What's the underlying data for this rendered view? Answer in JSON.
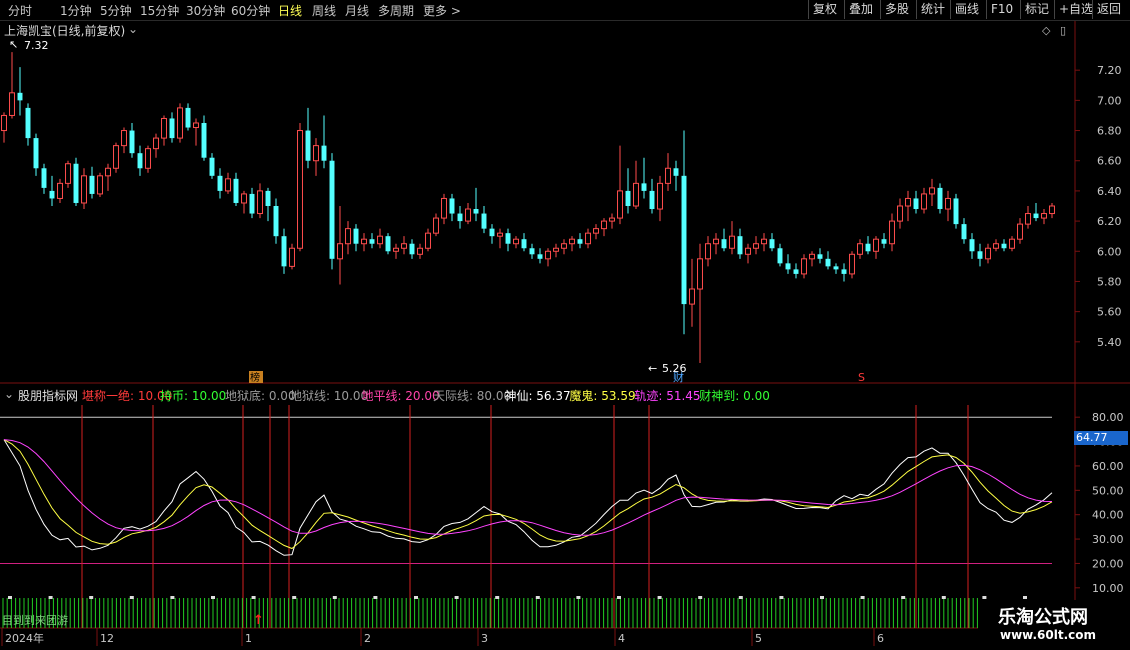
{
  "toolbar": {
    "periods": [
      "分时",
      "1分钟",
      "5分钟",
      "15分钟",
      "30分钟",
      "60分钟",
      "日线",
      "周线",
      "月线",
      "多周期",
      "更多 >"
    ],
    "active_period": "日线",
    "right_buttons": [
      "复权",
      "叠加",
      "多股",
      "统计",
      "画线",
      "F10",
      "标记",
      "+自选",
      "返回"
    ]
  },
  "chart_header": {
    "stock_title": "上海凯宝(日线,前复权)",
    "dropdown_icon": "chevron-down-icon"
  },
  "price_axis": [
    "7.20",
    "7.00",
    "6.80",
    "6.60",
    "6.40",
    "6.20",
    "6.00",
    "5.80",
    "5.60",
    "5.40"
  ],
  "annotations": {
    "high_label": "7.32",
    "low_label": "5.26",
    "tag_bang": "榜",
    "tag_cai": "财",
    "tag_s": "S"
  },
  "indicator": {
    "name": "股朋指标网",
    "items": [
      {
        "label": "堪称一绝:",
        "value": "10.00",
        "color": "#ff3a3a"
      },
      {
        "label": "持币:",
        "value": "10.00",
        "color": "#33ff33"
      },
      {
        "label": "地狱底:",
        "value": "0.00",
        "color": "#9a9a9a"
      },
      {
        "label": "地狱线:",
        "value": "10.00",
        "color": "#9a9a9a"
      },
      {
        "label": "地平线:",
        "value": "20.00",
        "color": "#ff44aa"
      },
      {
        "label": "天际线:",
        "value": "80.00",
        "color": "#9a9a9a"
      },
      {
        "label": "神仙:",
        "value": "56.37",
        "color": "#ffffff"
      },
      {
        "label": "魔鬼:",
        "value": "53.59",
        "color": "#ffff44"
      },
      {
        "label": "轨迹:",
        "value": "51.45",
        "color": "#ff44ff"
      },
      {
        "label": "财神到:",
        "value": "0.00",
        "color": "#33ff33"
      }
    ],
    "current_value": "64.77",
    "bottom_text": "目到到来团游"
  },
  "indicator_axis": [
    "80.00",
    "70.00",
    "60.00",
    "50.00",
    "40.00",
    "30.00",
    "20.00",
    "10.00"
  ],
  "date_axis": [
    {
      "label": "2024年"
    },
    {
      "label": "12"
    },
    {
      "label": "1"
    },
    {
      "label": "2"
    },
    {
      "label": "3"
    },
    {
      "label": "4"
    },
    {
      "label": "5"
    },
    {
      "label": "6"
    }
  ],
  "watermark": {
    "line1": "乐淘公式网",
    "line2": "www.60lt.com"
  },
  "colors": {
    "up": "#ff4d4d",
    "down": "#54ffff",
    "active": "#ffff55",
    "signal": "#d42020"
  },
  "chart_data": {
    "type": "candlestick",
    "ylim": [
      5.2,
      7.4
    ],
    "ohlc": [
      [
        6.8,
        6.92,
        6.72,
        6.9
      ],
      [
        6.9,
        7.32,
        6.88,
        7.05
      ],
      [
        7.05,
        7.22,
        6.9,
        7.0
      ],
      [
        6.95,
        6.98,
        6.7,
        6.75
      ],
      [
        6.75,
        6.78,
        6.5,
        6.55
      ],
      [
        6.55,
        6.58,
        6.38,
        6.42
      ],
      [
        6.4,
        6.5,
        6.3,
        6.35
      ],
      [
        6.35,
        6.48,
        6.32,
        6.45
      ],
      [
        6.45,
        6.6,
        6.42,
        6.58
      ],
      [
        6.58,
        6.62,
        6.3,
        6.32
      ],
      [
        6.32,
        6.55,
        6.28,
        6.5
      ],
      [
        6.5,
        6.56,
        6.35,
        6.38
      ],
      [
        6.38,
        6.52,
        6.36,
        6.5
      ],
      [
        6.5,
        6.58,
        6.4,
        6.55
      ],
      [
        6.55,
        6.72,
        6.52,
        6.7
      ],
      [
        6.7,
        6.82,
        6.65,
        6.8
      ],
      [
        6.8,
        6.85,
        6.62,
        6.65
      ],
      [
        6.65,
        6.7,
        6.5,
        6.55
      ],
      [
        6.55,
        6.7,
        6.52,
        6.68
      ],
      [
        6.68,
        6.78,
        6.62,
        6.75
      ],
      [
        6.75,
        6.9,
        6.7,
        6.88
      ],
      [
        6.88,
        6.92,
        6.72,
        6.75
      ],
      [
        6.75,
        6.98,
        6.72,
        6.95
      ],
      [
        6.95,
        6.98,
        6.8,
        6.82
      ],
      [
        6.82,
        6.88,
        6.7,
        6.85
      ],
      [
        6.85,
        6.9,
        6.6,
        6.62
      ],
      [
        6.62,
        6.65,
        6.48,
        6.5
      ],
      [
        6.5,
        6.55,
        6.35,
        6.4
      ],
      [
        6.4,
        6.52,
        6.38,
        6.48
      ],
      [
        6.48,
        6.52,
        6.3,
        6.32
      ],
      [
        6.32,
        6.4,
        6.25,
        6.38
      ],
      [
        6.38,
        6.42,
        6.22,
        6.25
      ],
      [
        6.25,
        6.45,
        6.22,
        6.4
      ],
      [
        6.4,
        6.42,
        6.2,
        6.3
      ],
      [
        6.3,
        6.35,
        6.05,
        6.1
      ],
      [
        6.1,
        6.15,
        5.85,
        5.9
      ],
      [
        5.9,
        6.05,
        5.88,
        6.02
      ],
      [
        6.02,
        6.85,
        6.0,
        6.8
      ],
      [
        6.8,
        6.95,
        6.55,
        6.6
      ],
      [
        6.6,
        6.75,
        6.5,
        6.7
      ],
      [
        6.7,
        6.9,
        6.55,
        6.6
      ],
      [
        6.6,
        6.65,
        5.88,
        5.95
      ],
      [
        5.95,
        6.3,
        5.78,
        6.05
      ],
      [
        6.05,
        6.2,
        5.98,
        6.15
      ],
      [
        6.15,
        6.18,
        6.0,
        6.05
      ],
      [
        6.05,
        6.12,
        6.0,
        6.08
      ],
      [
        6.08,
        6.12,
        6.02,
        6.05
      ],
      [
        6.05,
        6.15,
        6.02,
        6.1
      ],
      [
        6.1,
        6.12,
        5.98,
        6.0
      ],
      [
        6.0,
        6.05,
        5.95,
        6.02
      ],
      [
        6.02,
        6.1,
        5.98,
        6.05
      ],
      [
        6.05,
        6.08,
        5.95,
        5.98
      ],
      [
        5.98,
        6.05,
        5.95,
        6.02
      ],
      [
        6.02,
        6.15,
        6.0,
        6.12
      ],
      [
        6.12,
        6.25,
        6.1,
        6.22
      ],
      [
        6.22,
        6.38,
        6.18,
        6.35
      ],
      [
        6.35,
        6.38,
        6.2,
        6.25
      ],
      [
        6.25,
        6.3,
        6.15,
        6.2
      ],
      [
        6.2,
        6.32,
        6.18,
        6.28
      ],
      [
        6.28,
        6.42,
        6.2,
        6.25
      ],
      [
        6.25,
        6.3,
        6.12,
        6.15
      ],
      [
        6.15,
        6.18,
        6.05,
        6.1
      ],
      [
        6.1,
        6.15,
        6.02,
        6.12
      ],
      [
        6.12,
        6.15,
        6.0,
        6.05
      ],
      [
        6.05,
        6.1,
        6.02,
        6.08
      ],
      [
        6.08,
        6.12,
        6.0,
        6.02
      ],
      [
        6.02,
        6.05,
        5.95,
        5.98
      ],
      [
        5.98,
        6.02,
        5.92,
        5.95
      ],
      [
        5.95,
        6.02,
        5.9,
        6.0
      ],
      [
        6.0,
        6.05,
        5.96,
        6.02
      ],
      [
        6.02,
        6.08,
        5.98,
        6.05
      ],
      [
        6.05,
        6.1,
        6.0,
        6.08
      ],
      [
        6.08,
        6.12,
        6.02,
        6.05
      ],
      [
        6.05,
        6.15,
        6.02,
        6.12
      ],
      [
        6.12,
        6.18,
        6.08,
        6.15
      ],
      [
        6.15,
        6.22,
        6.1,
        6.2
      ],
      [
        6.2,
        6.25,
        6.15,
        6.22
      ],
      [
        6.22,
        6.7,
        6.18,
        6.4
      ],
      [
        6.4,
        6.55,
        6.25,
        6.3
      ],
      [
        6.3,
        6.6,
        6.28,
        6.45
      ],
      [
        6.45,
        6.62,
        6.35,
        6.4
      ],
      [
        6.4,
        6.48,
        6.25,
        6.28
      ],
      [
        6.28,
        6.5,
        6.2,
        6.45
      ],
      [
        6.45,
        6.65,
        6.4,
        6.55
      ],
      [
        6.55,
        6.6,
        6.4,
        6.5
      ],
      [
        6.5,
        6.8,
        5.45,
        5.65
      ],
      [
        5.65,
        5.95,
        5.5,
        5.75
      ],
      [
        5.75,
        6.05,
        5.26,
        5.95
      ],
      [
        5.95,
        6.1,
        5.9,
        6.05
      ],
      [
        6.05,
        6.12,
        5.98,
        6.08
      ],
      [
        6.08,
        6.15,
        6.0,
        6.02
      ],
      [
        6.02,
        6.2,
        5.98,
        6.1
      ],
      [
        6.1,
        6.15,
        5.95,
        5.98
      ],
      [
        5.98,
        6.05,
        5.92,
        6.02
      ],
      [
        6.02,
        6.1,
        5.98,
        6.05
      ],
      [
        6.05,
        6.12,
        6.0,
        6.08
      ],
      [
        6.08,
        6.12,
        6.0,
        6.02
      ],
      [
        6.02,
        6.05,
        5.9,
        5.92
      ],
      [
        5.92,
        5.98,
        5.85,
        5.88
      ],
      [
        5.88,
        5.92,
        5.82,
        5.85
      ],
      [
        5.85,
        5.98,
        5.82,
        5.95
      ],
      [
        5.95,
        6.0,
        5.9,
        5.98
      ],
      [
        5.98,
        6.02,
        5.92,
        5.95
      ],
      [
        5.95,
        6.0,
        5.88,
        5.9
      ],
      [
        5.9,
        5.92,
        5.85,
        5.88
      ],
      [
        5.88,
        5.92,
        5.8,
        5.85
      ],
      [
        5.85,
        6.0,
        5.82,
        5.98
      ],
      [
        5.98,
        6.08,
        5.95,
        6.05
      ],
      [
        6.05,
        6.1,
        5.98,
        6.0
      ],
      [
        6.0,
        6.1,
        5.95,
        6.08
      ],
      [
        6.08,
        6.12,
        6.02,
        6.05
      ],
      [
        6.05,
        6.25,
        6.0,
        6.2
      ],
      [
        6.2,
        6.35,
        6.15,
        6.3
      ],
      [
        6.3,
        6.4,
        6.2,
        6.35
      ],
      [
        6.35,
        6.4,
        6.25,
        6.28
      ],
      [
        6.28,
        6.42,
        6.25,
        6.38
      ],
      [
        6.38,
        6.48,
        6.3,
        6.42
      ],
      [
        6.42,
        6.45,
        6.25,
        6.28
      ],
      [
        6.28,
        6.4,
        6.2,
        6.35
      ],
      [
        6.35,
        6.38,
        6.15,
        6.18
      ],
      [
        6.18,
        6.22,
        6.05,
        6.08
      ],
      [
        6.08,
        6.12,
        5.95,
        6.0
      ],
      [
        6.0,
        6.05,
        5.9,
        5.95
      ],
      [
        5.95,
        6.05,
        5.92,
        6.02
      ],
      [
        6.02,
        6.08,
        6.0,
        6.05
      ],
      [
        6.05,
        6.08,
        6.0,
        6.02
      ],
      [
        6.02,
        6.1,
        6.0,
        6.08
      ],
      [
        6.08,
        6.22,
        6.05,
        6.18
      ],
      [
        6.18,
        6.3,
        6.15,
        6.25
      ],
      [
        6.25,
        6.32,
        6.2,
        6.22
      ],
      [
        6.22,
        6.28,
        6.18,
        6.25
      ],
      [
        6.25,
        6.32,
        6.22,
        6.3
      ]
    ],
    "indicator_series": [
      "神仙",
      "魔鬼",
      "轨迹"
    ],
    "indicator_ylim": [
      5,
      85
    ]
  }
}
